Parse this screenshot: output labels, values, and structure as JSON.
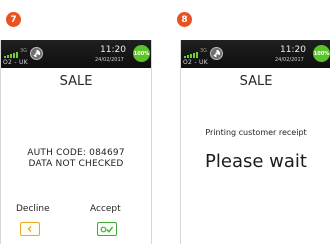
{
  "steps": [
    "7",
    "8"
  ],
  "screens": [
    {
      "status": {
        "network": "3G",
        "carrier": "O2 - UK",
        "time": "11:20",
        "date": "24/02/2017",
        "battery": "100%"
      },
      "title": "SALE",
      "auth_code": "AUTH CODE: 084697",
      "check_status": "DATA NOT CHECKED",
      "decline_label": "Decline",
      "accept_label": "Accept"
    },
    {
      "status": {
        "network": "3G",
        "carrier": "O2 - UK",
        "time": "11:20",
        "date": "24/02/2017",
        "battery": "100%"
      },
      "title": "SALE",
      "message": "Printing customer receipt",
      "wait_text": "Please wait"
    }
  ],
  "colors": {
    "badge": "#e8531f",
    "decline": "#e9a825",
    "accept": "#44a83f",
    "signal": "#6fd12f",
    "battery": "#5cc229"
  }
}
